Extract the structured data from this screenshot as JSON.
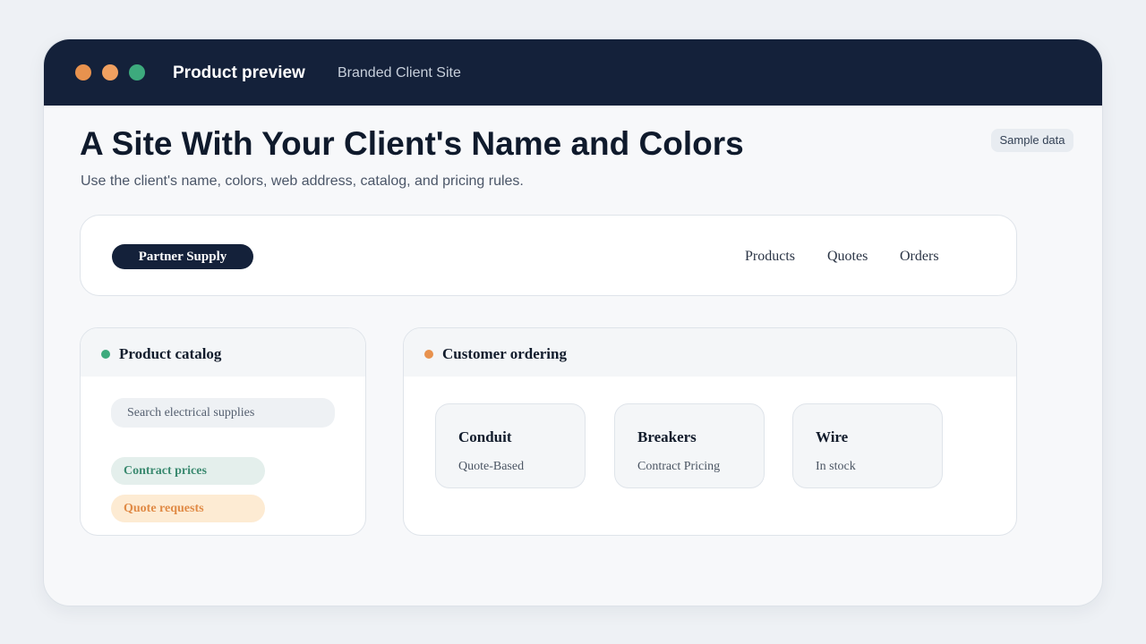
{
  "window": {
    "title": "Product preview",
    "subtitle": "Branded Client Site",
    "controls": [
      "close-dot",
      "minimize-dot",
      "maximize-dot"
    ]
  },
  "page": {
    "title": "A Site With Your Client's Name and Colors",
    "subtitle": "Use the client's name, colors, web address, catalog, and pricing rules.",
    "badge": "Sample data"
  },
  "site_nav": {
    "brand": "Partner Supply",
    "links": [
      "Products",
      "Quotes",
      "Orders"
    ]
  },
  "catalog": {
    "title": "Product catalog",
    "search_placeholder": "Search electrical supplies",
    "chips": [
      "Contract prices",
      "Quote requests"
    ]
  },
  "ordering": {
    "title": "Customer ordering",
    "products": [
      {
        "name": "Conduit",
        "status": "Quote-Based"
      },
      {
        "name": "Breakers",
        "status": "Contract Pricing"
      },
      {
        "name": "Wire",
        "status": "In stock"
      }
    ]
  },
  "colors": {
    "navy": "#14213a",
    "orange": "#e8924e",
    "green": "#3daa7d",
    "background": "#eef1f5"
  }
}
